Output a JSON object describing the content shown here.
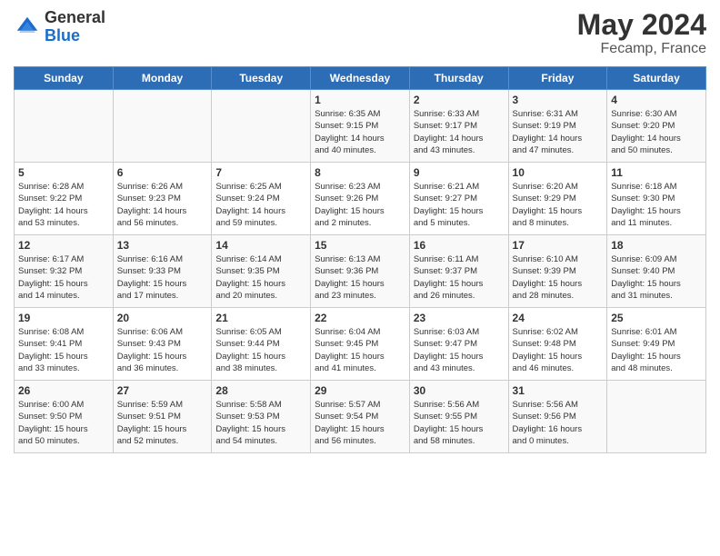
{
  "header": {
    "logo_general": "General",
    "logo_blue": "Blue",
    "title": "May 2024",
    "subtitle": "Fecamp, France"
  },
  "weekdays": [
    "Sunday",
    "Monday",
    "Tuesday",
    "Wednesday",
    "Thursday",
    "Friday",
    "Saturday"
  ],
  "weeks": [
    [
      {
        "day": "",
        "text": ""
      },
      {
        "day": "",
        "text": ""
      },
      {
        "day": "",
        "text": ""
      },
      {
        "day": "1",
        "text": "Sunrise: 6:35 AM\nSunset: 9:15 PM\nDaylight: 14 hours\nand 40 minutes."
      },
      {
        "day": "2",
        "text": "Sunrise: 6:33 AM\nSunset: 9:17 PM\nDaylight: 14 hours\nand 43 minutes."
      },
      {
        "day": "3",
        "text": "Sunrise: 6:31 AM\nSunset: 9:19 PM\nDaylight: 14 hours\nand 47 minutes."
      },
      {
        "day": "4",
        "text": "Sunrise: 6:30 AM\nSunset: 9:20 PM\nDaylight: 14 hours\nand 50 minutes."
      }
    ],
    [
      {
        "day": "5",
        "text": "Sunrise: 6:28 AM\nSunset: 9:22 PM\nDaylight: 14 hours\nand 53 minutes."
      },
      {
        "day": "6",
        "text": "Sunrise: 6:26 AM\nSunset: 9:23 PM\nDaylight: 14 hours\nand 56 minutes."
      },
      {
        "day": "7",
        "text": "Sunrise: 6:25 AM\nSunset: 9:24 PM\nDaylight: 14 hours\nand 59 minutes."
      },
      {
        "day": "8",
        "text": "Sunrise: 6:23 AM\nSunset: 9:26 PM\nDaylight: 15 hours\nand 2 minutes."
      },
      {
        "day": "9",
        "text": "Sunrise: 6:21 AM\nSunset: 9:27 PM\nDaylight: 15 hours\nand 5 minutes."
      },
      {
        "day": "10",
        "text": "Sunrise: 6:20 AM\nSunset: 9:29 PM\nDaylight: 15 hours\nand 8 minutes."
      },
      {
        "day": "11",
        "text": "Sunrise: 6:18 AM\nSunset: 9:30 PM\nDaylight: 15 hours\nand 11 minutes."
      }
    ],
    [
      {
        "day": "12",
        "text": "Sunrise: 6:17 AM\nSunset: 9:32 PM\nDaylight: 15 hours\nand 14 minutes."
      },
      {
        "day": "13",
        "text": "Sunrise: 6:16 AM\nSunset: 9:33 PM\nDaylight: 15 hours\nand 17 minutes."
      },
      {
        "day": "14",
        "text": "Sunrise: 6:14 AM\nSunset: 9:35 PM\nDaylight: 15 hours\nand 20 minutes."
      },
      {
        "day": "15",
        "text": "Sunrise: 6:13 AM\nSunset: 9:36 PM\nDaylight: 15 hours\nand 23 minutes."
      },
      {
        "day": "16",
        "text": "Sunrise: 6:11 AM\nSunset: 9:37 PM\nDaylight: 15 hours\nand 26 minutes."
      },
      {
        "day": "17",
        "text": "Sunrise: 6:10 AM\nSunset: 9:39 PM\nDaylight: 15 hours\nand 28 minutes."
      },
      {
        "day": "18",
        "text": "Sunrise: 6:09 AM\nSunset: 9:40 PM\nDaylight: 15 hours\nand 31 minutes."
      }
    ],
    [
      {
        "day": "19",
        "text": "Sunrise: 6:08 AM\nSunset: 9:41 PM\nDaylight: 15 hours\nand 33 minutes."
      },
      {
        "day": "20",
        "text": "Sunrise: 6:06 AM\nSunset: 9:43 PM\nDaylight: 15 hours\nand 36 minutes."
      },
      {
        "day": "21",
        "text": "Sunrise: 6:05 AM\nSunset: 9:44 PM\nDaylight: 15 hours\nand 38 minutes."
      },
      {
        "day": "22",
        "text": "Sunrise: 6:04 AM\nSunset: 9:45 PM\nDaylight: 15 hours\nand 41 minutes."
      },
      {
        "day": "23",
        "text": "Sunrise: 6:03 AM\nSunset: 9:47 PM\nDaylight: 15 hours\nand 43 minutes."
      },
      {
        "day": "24",
        "text": "Sunrise: 6:02 AM\nSunset: 9:48 PM\nDaylight: 15 hours\nand 46 minutes."
      },
      {
        "day": "25",
        "text": "Sunrise: 6:01 AM\nSunset: 9:49 PM\nDaylight: 15 hours\nand 48 minutes."
      }
    ],
    [
      {
        "day": "26",
        "text": "Sunrise: 6:00 AM\nSunset: 9:50 PM\nDaylight: 15 hours\nand 50 minutes."
      },
      {
        "day": "27",
        "text": "Sunrise: 5:59 AM\nSunset: 9:51 PM\nDaylight: 15 hours\nand 52 minutes."
      },
      {
        "day": "28",
        "text": "Sunrise: 5:58 AM\nSunset: 9:53 PM\nDaylight: 15 hours\nand 54 minutes."
      },
      {
        "day": "29",
        "text": "Sunrise: 5:57 AM\nSunset: 9:54 PM\nDaylight: 15 hours\nand 56 minutes."
      },
      {
        "day": "30",
        "text": "Sunrise: 5:56 AM\nSunset: 9:55 PM\nDaylight: 15 hours\nand 58 minutes."
      },
      {
        "day": "31",
        "text": "Sunrise: 5:56 AM\nSunset: 9:56 PM\nDaylight: 16 hours\nand 0 minutes."
      },
      {
        "day": "",
        "text": ""
      }
    ]
  ]
}
